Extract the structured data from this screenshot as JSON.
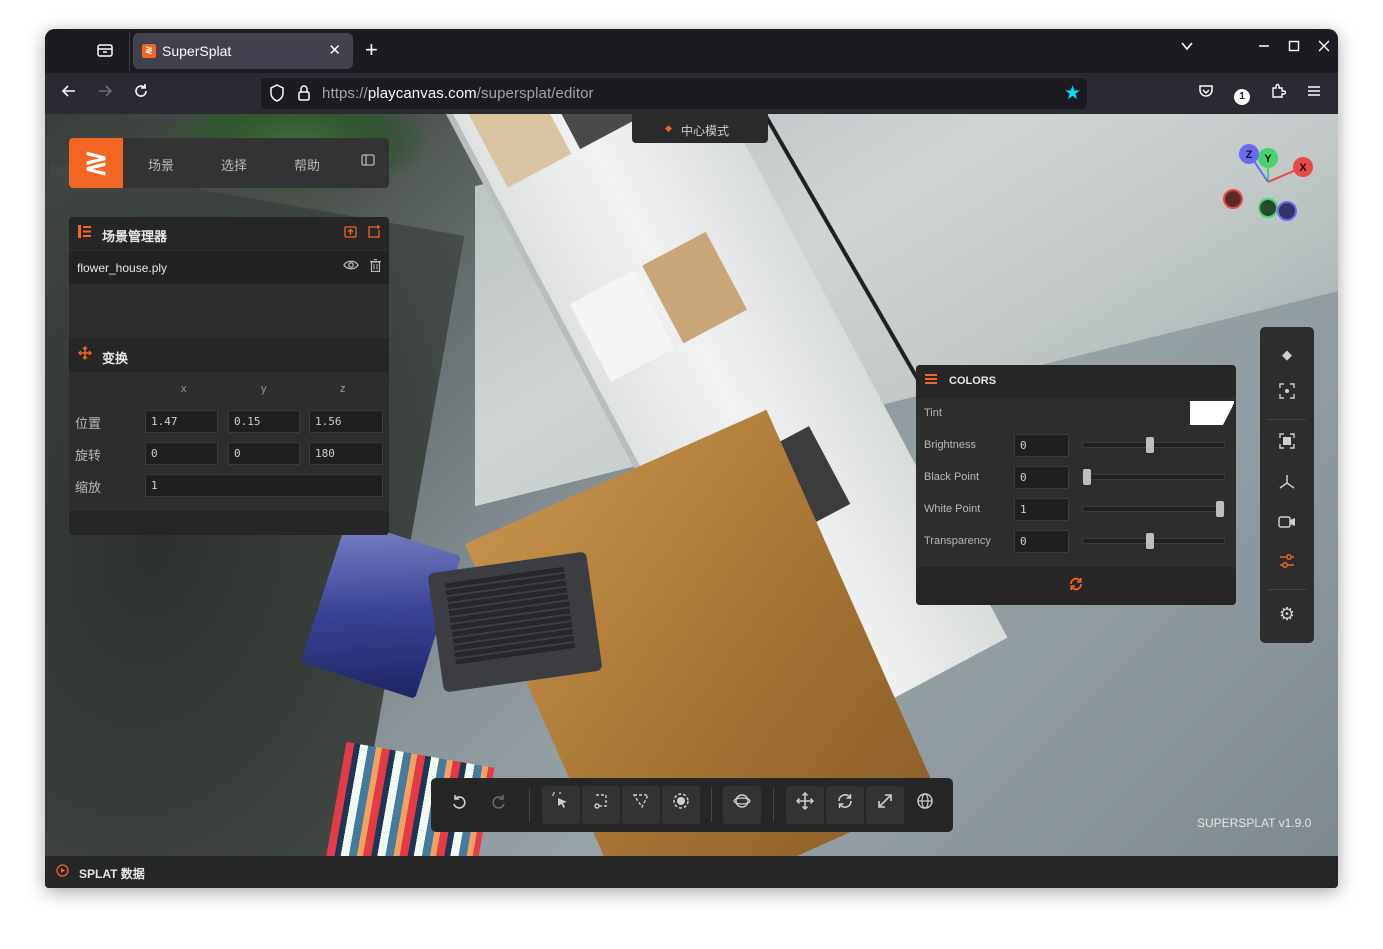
{
  "browser": {
    "tab_title": "SuperSplat",
    "url_prefix": "https://",
    "url_host": "playcanvas.com",
    "url_path": "/supersplat/editor",
    "notification_count": "1"
  },
  "menu": {
    "items": [
      "场景",
      "选择",
      "帮助"
    ]
  },
  "scene_manager": {
    "title": "场景管理器",
    "file_name": "flower_house.ply"
  },
  "transform": {
    "title": "变换",
    "axes": [
      "x",
      "y",
      "z"
    ],
    "position_label": "位置",
    "rotation_label": "旋转",
    "scale_label": "缩放",
    "position": [
      "1.47",
      "0.15",
      "1.56"
    ],
    "rotation": [
      "0",
      "0",
      "180"
    ],
    "scale": "1"
  },
  "mode": {
    "label": "中心模式"
  },
  "gizmo": {
    "x": "X",
    "y": "Y",
    "z": "Z"
  },
  "colors": {
    "title": "COLORS",
    "tint_label": "Tint",
    "tint_color": "#ffffff",
    "sliders": [
      {
        "label": "Brightness",
        "value": "0",
        "fraction": 0.47
      },
      {
        "label": "Black Point",
        "value": "0",
        "fraction": 0.0
      },
      {
        "label": "White Point",
        "value": "1",
        "fraction": 1.0
      },
      {
        "label": "Transparency",
        "value": "0",
        "fraction": 0.47
      }
    ]
  },
  "version": "SUPERSPLAT v1.9.0",
  "status": {
    "label": "SPLAT 数据"
  },
  "accent_color": "#f26522"
}
